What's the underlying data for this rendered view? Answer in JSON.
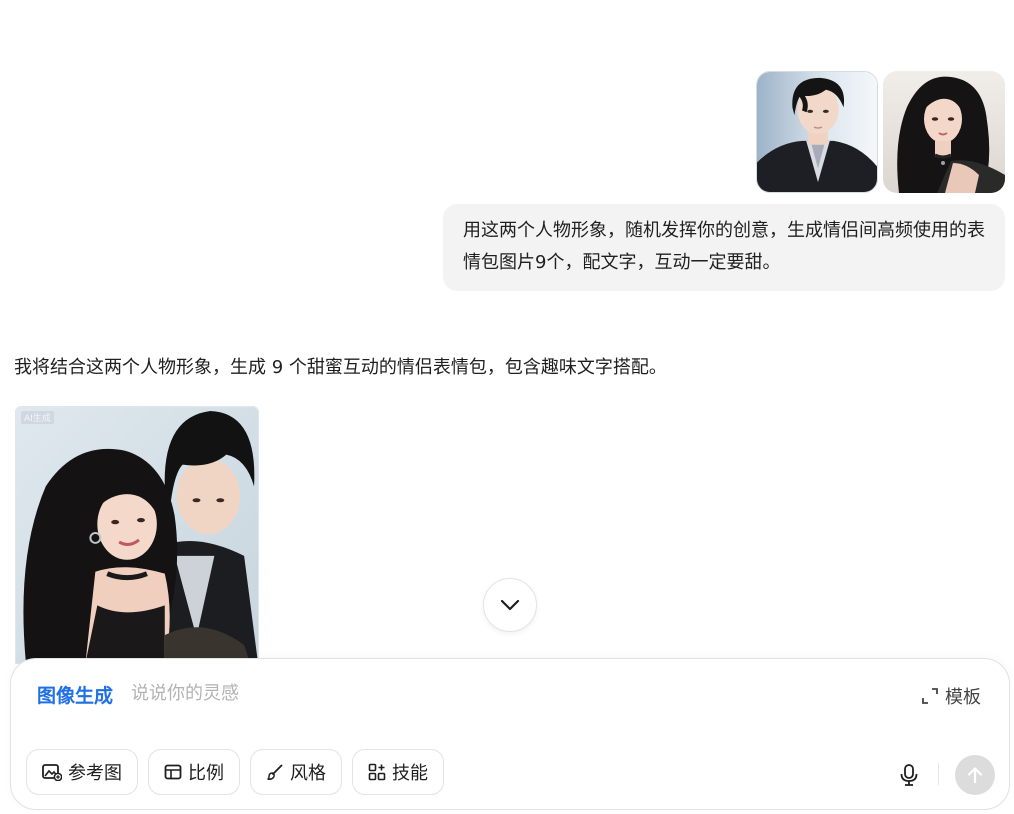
{
  "conversation": {
    "user_message": {
      "images": [
        {
          "alt": "男性人物形象",
          "icon": "portrait-man"
        },
        {
          "alt": "女性人物形象",
          "icon": "portrait-woman"
        }
      ],
      "text": "用这两个人物形象，随机发挥你的创意，生成情侣间高频使用的表情包图片9个，配文字，互动一定要甜。"
    },
    "assistant_message": {
      "text": "我将结合这两个人物形象，生成 9 个甜蜜互动的情侣表情包，包含趣味文字搭配。",
      "image_badge": "AI生成"
    }
  },
  "composer": {
    "mode_label": "图像生成",
    "placeholder": "说说你的灵感",
    "template_label": "模板",
    "tools": [
      {
        "label": "参考图",
        "icon": "image-add-icon"
      },
      {
        "label": "比例",
        "icon": "aspect-ratio-icon"
      },
      {
        "label": "风格",
        "icon": "brush-icon"
      },
      {
        "label": "技能",
        "icon": "apps-icon"
      }
    ]
  },
  "colors": {
    "accent": "#1f6fe5",
    "bubble": "#f3f3f3",
    "send_disabled": "#dcdcdc"
  }
}
